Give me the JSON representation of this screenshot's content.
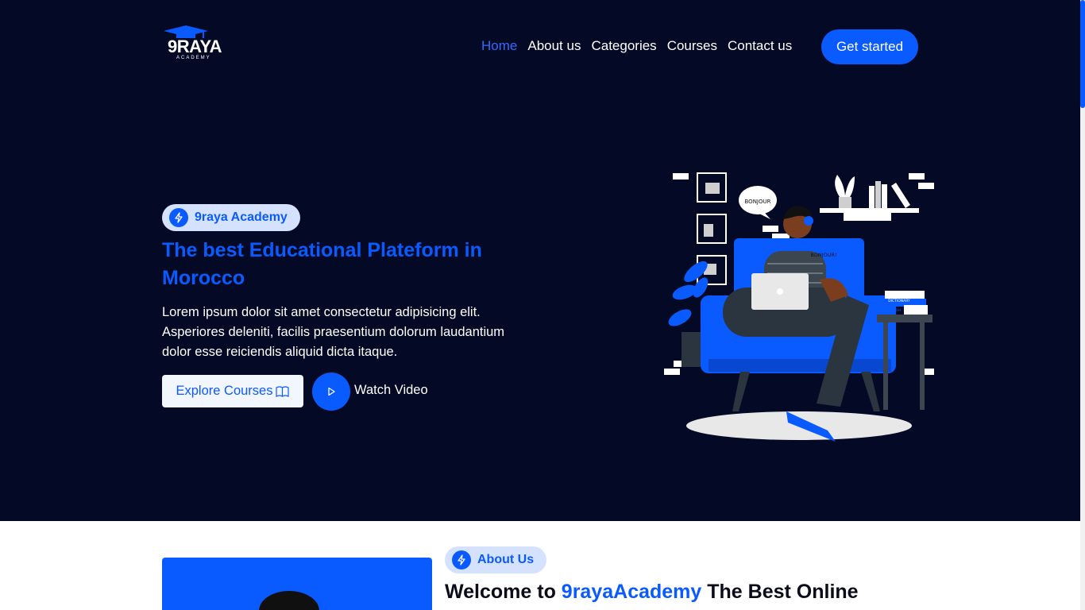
{
  "brand": {
    "logo_text": "9RAYA",
    "logo_sub": "ACADEMY"
  },
  "nav": {
    "items": [
      {
        "label": "Home",
        "active": true
      },
      {
        "label": "About us",
        "active": false
      },
      {
        "label": "Categories",
        "active": false
      },
      {
        "label": "Courses",
        "active": false
      },
      {
        "label": "Contact us",
        "active": false
      }
    ],
    "cta_label": "Get started"
  },
  "hero": {
    "badge": "9raya Academy",
    "title": "The best Educational Plateform in Morocco",
    "description": "Lorem ipsum dolor sit amet consectetur adipisicing elit. Asperiores deleniti, facilis praesentium dolorum laudantium dolor esse reiciendis aliquid dicta itaque.",
    "explore_label": "Explore Courses",
    "watch_label": "Watch Video",
    "illustration": {
      "bubble_1": "BONJOUR",
      "bubble_2": "BONJOUR!",
      "book_1": "DICTIONARY",
      "book_2": "ENGLISH"
    }
  },
  "about": {
    "badge": "About Us",
    "title_prefix": "Welcome to ",
    "title_highlight": "9rayaAcademy",
    "title_suffix": " The Best Online"
  },
  "colors": {
    "accent": "#0a5bff",
    "hero_bg": "#040a26",
    "badge_bg": "#d5e2ff"
  }
}
